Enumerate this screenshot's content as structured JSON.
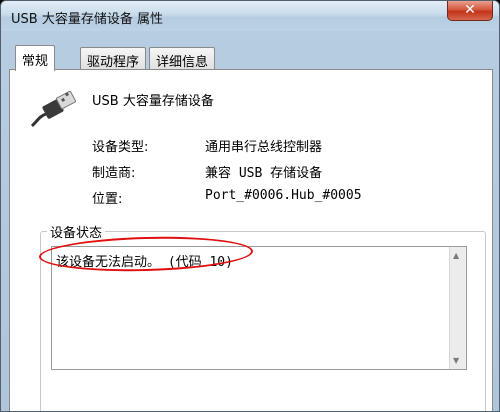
{
  "window": {
    "title": "USB 大容量存储设备 属性",
    "close_glyph": "✕"
  },
  "tabs": [
    {
      "label": "常规",
      "active": true
    },
    {
      "label": "驱动程序",
      "active": false
    },
    {
      "label": "详细信息",
      "active": false
    }
  ],
  "device": {
    "name": "USB 大容量存储设备",
    "icon": "usb-connector-icon"
  },
  "properties": [
    {
      "label": "设备类型:",
      "value": "通用串行总线控制器"
    },
    {
      "label": "制造商:",
      "value": "兼容 USB 存储设备"
    },
    {
      "label": "位置:",
      "value": "Port_#0006.Hub_#0005"
    }
  ],
  "status": {
    "legend": "设备状态",
    "text": "该设备无法启动。 (代码 10)",
    "scroll_up": "▲",
    "scroll_down": "▼"
  },
  "colors": {
    "highlight": "#e01010",
    "close_button": "#c2341a"
  }
}
